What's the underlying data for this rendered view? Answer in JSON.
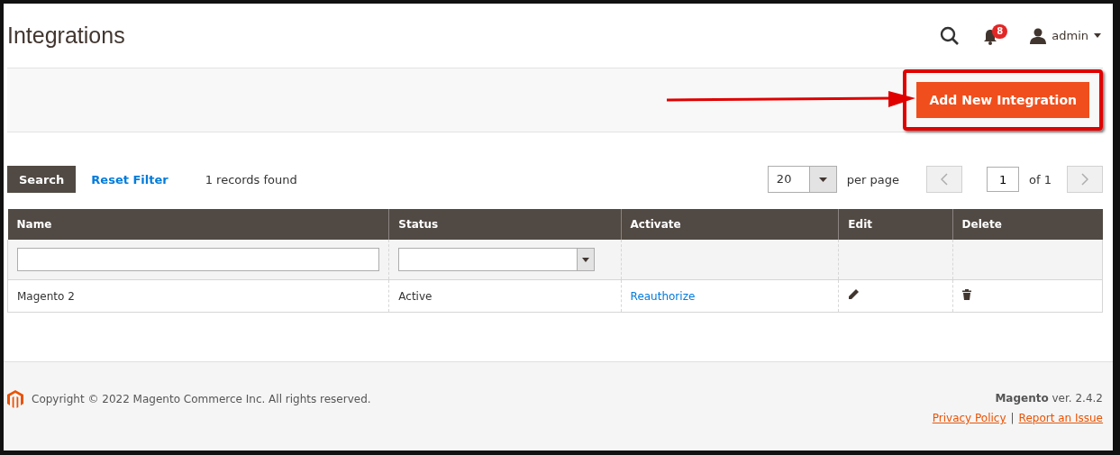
{
  "page": {
    "title": "Integrations"
  },
  "header": {
    "notifications": "8",
    "user": "admin"
  },
  "actions": {
    "primary_button": "Add New Integration",
    "highlighted": true
  },
  "grid": {
    "search_button": "Search",
    "reset_link": "Reset Filter",
    "records": "1 records found",
    "per_page_value": "20",
    "per_page_label": "per page",
    "page": "1",
    "page_total": "of 1"
  },
  "table": {
    "columns": [
      "Name",
      "Status",
      "Activate",
      "Edit",
      "Delete"
    ],
    "filters": [
      {
        "kind": "text"
      },
      {
        "kind": "select"
      },
      {
        "kind": "none"
      },
      {
        "kind": "none"
      },
      {
        "kind": "none"
      }
    ],
    "rows": [
      {
        "cells": [
          {
            "kind": "text",
            "text": "Magento 2"
          },
          {
            "kind": "text",
            "text": "Active"
          },
          {
            "kind": "link",
            "text": "Reauthorize"
          },
          {
            "kind": "edit"
          },
          {
            "kind": "delete"
          }
        ]
      }
    ]
  },
  "footer": {
    "copyright": "Copyright © 2022 Magento Commerce Inc. All rights reserved.",
    "version": "**Magento** ver. 2.4.2",
    "links": [
      "Privacy Policy",
      "Report an Issue"
    ],
    "separator": "|"
  }
}
